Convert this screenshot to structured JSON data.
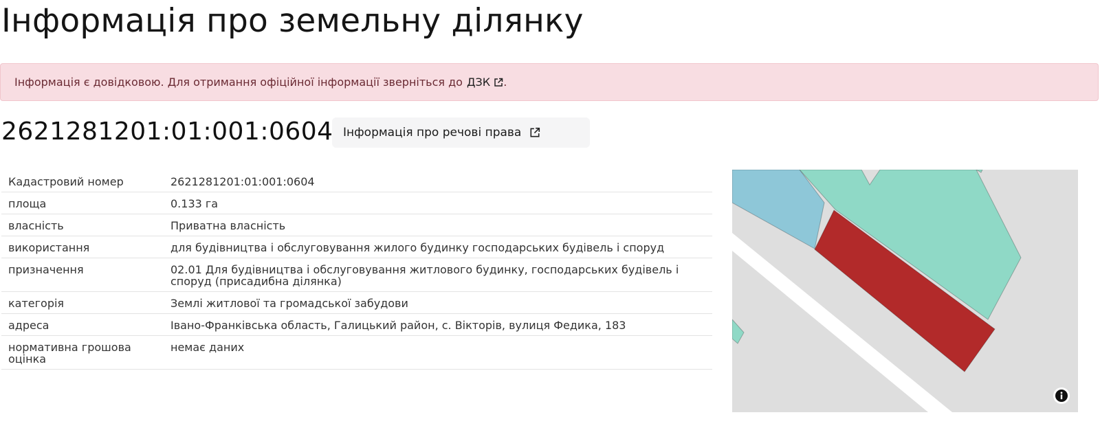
{
  "page": {
    "title": "Інформація про земельну ділянку"
  },
  "alert": {
    "text": "Інформація є довідковою. Для отримання офіційної інформації зверніться до",
    "link_label": "ДЗК",
    "tail": "."
  },
  "parcel": {
    "cadastral_heading": "2621281201:01:001:0604",
    "rights_button_label": "Інформація про речові права"
  },
  "details": [
    {
      "label": "Кадастровий номер",
      "value": "2621281201:01:001:0604"
    },
    {
      "label": "площа",
      "value": "0.133 га"
    },
    {
      "label": "власність",
      "value": "Приватна власність"
    },
    {
      "label": "використання",
      "value": "для будівництва і обслуговування жилого будинку господарських будівель і споруд"
    },
    {
      "label": "призначення",
      "value": "02.01 Для будівництва і обслуговування житлового будинку, господарських будівель і споруд (присадибна ділянка)"
    },
    {
      "label": "категорія",
      "value": "Землі житлової та громадської забудови"
    },
    {
      "label": "адреса",
      "value": "Івано-Франківська область, Галицький район, с. Вікторів, вулиця Федика, 183"
    },
    {
      "label": "нормативна грошова оцінка",
      "value": "немає даних"
    }
  ],
  "map": {
    "icons": {
      "info": "info-icon",
      "external": "external-link-icon"
    },
    "colors": {
      "background": "#dedede",
      "road": "#ffffff",
      "selected_parcel": "#b22a2a",
      "neighbor_parcel": "#8fd9c6",
      "blue_parcel": "#8ec7d8"
    }
  }
}
